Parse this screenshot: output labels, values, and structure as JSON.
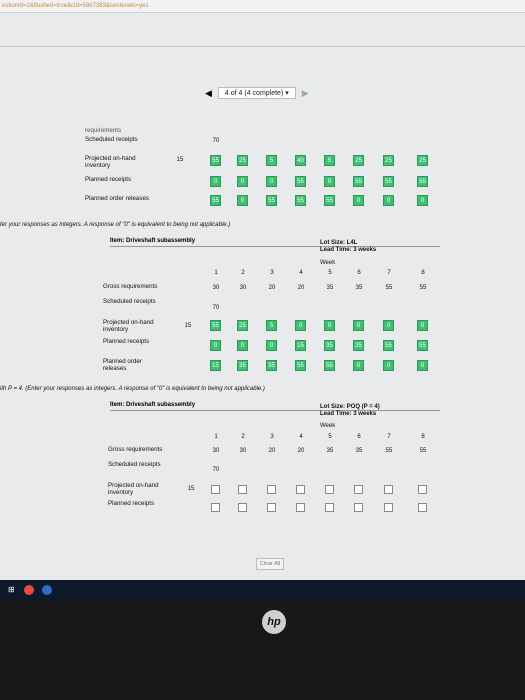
{
  "url_text": "estionId=2&flushed=true&cId=5867383&centerwin=yes",
  "nav": {
    "progress_label": "4 of 4 (4 complete) ▾",
    "prev": "◀",
    "next": "▶"
  },
  "table1": {
    "cut_label": "requirements",
    "rows": [
      {
        "label": "Scheduled receipts",
        "first": "",
        "values": [
          "70",
          "",
          "",
          "",
          "",
          "",
          "",
          ""
        ]
      },
      {
        "label": "Projected on-hand inventory",
        "first": "15",
        "values": [
          "55",
          "25",
          "5",
          "40",
          "5",
          "25",
          "25",
          "25"
        ]
      },
      {
        "label": "Planned receipts",
        "first": "",
        "values": [
          "0",
          "0",
          "0",
          "55",
          "0",
          "55",
          "55",
          "55"
        ]
      },
      {
        "label": "Planned order releases",
        "first": "",
        "values": [
          "55",
          "0",
          "55",
          "55",
          "55",
          "0",
          "0",
          "0"
        ]
      }
    ]
  },
  "note1": "ter your responses as integers. A response of \"0\" is equivalent to being not applicable.)",
  "table2": {
    "item": "Item: Driveshaft subassembly",
    "lot_size": "Lot Size: L4L",
    "lead_time": "Lead Time: 3 weeks",
    "week_label": "Week",
    "weeks": [
      "1",
      "2",
      "3",
      "4",
      "5",
      "6",
      "7",
      "8"
    ],
    "gross_label": "Gross requirements",
    "gross": [
      "30",
      "30",
      "20",
      "20",
      "35",
      "35",
      "55",
      "55"
    ],
    "sched_label": "Scheduled receipts",
    "sched": [
      "70",
      "",
      "",
      "",
      "",
      "",
      "",
      ""
    ],
    "poh_label": "Projected on-hand inventory",
    "poh_start": "15",
    "poh": [
      "55",
      "25",
      "5",
      "0",
      "0",
      "0",
      "0",
      "0"
    ],
    "pr_label": "Planned receipts",
    "pr": [
      "0",
      "0",
      "0",
      "15",
      "35",
      "35",
      "55",
      "55"
    ],
    "por_label": "Planned order releases",
    "por": [
      "15",
      "35",
      "35",
      "55",
      "55",
      "0",
      "0",
      "0"
    ]
  },
  "note2": "ith P = 4. (Enter your responses as integers. A response of \"0\" is equivalent to being not applicable.)",
  "table3": {
    "item": "Item: Driveshaft subassembly",
    "lot_size": "Lot Size: POQ (P = 4)",
    "lead_time": "Lead Time: 3 weeks",
    "week_label": "Week",
    "weeks": [
      "1",
      "2",
      "3",
      "4",
      "5",
      "6",
      "7",
      "8"
    ],
    "gross_label": "Gross requirements",
    "gross": [
      "30",
      "30",
      "20",
      "20",
      "35",
      "35",
      "55",
      "55"
    ],
    "sched_label": "Scheduled receipts",
    "sched": [
      "70",
      "",
      "",
      "",
      "",
      "",
      "",
      ""
    ],
    "poh_label": "Projected on-hand inventory",
    "poh_start": "15",
    "pr_label": "Planned receipts"
  },
  "clear_all": "Clear All",
  "hp_logo": "hp"
}
